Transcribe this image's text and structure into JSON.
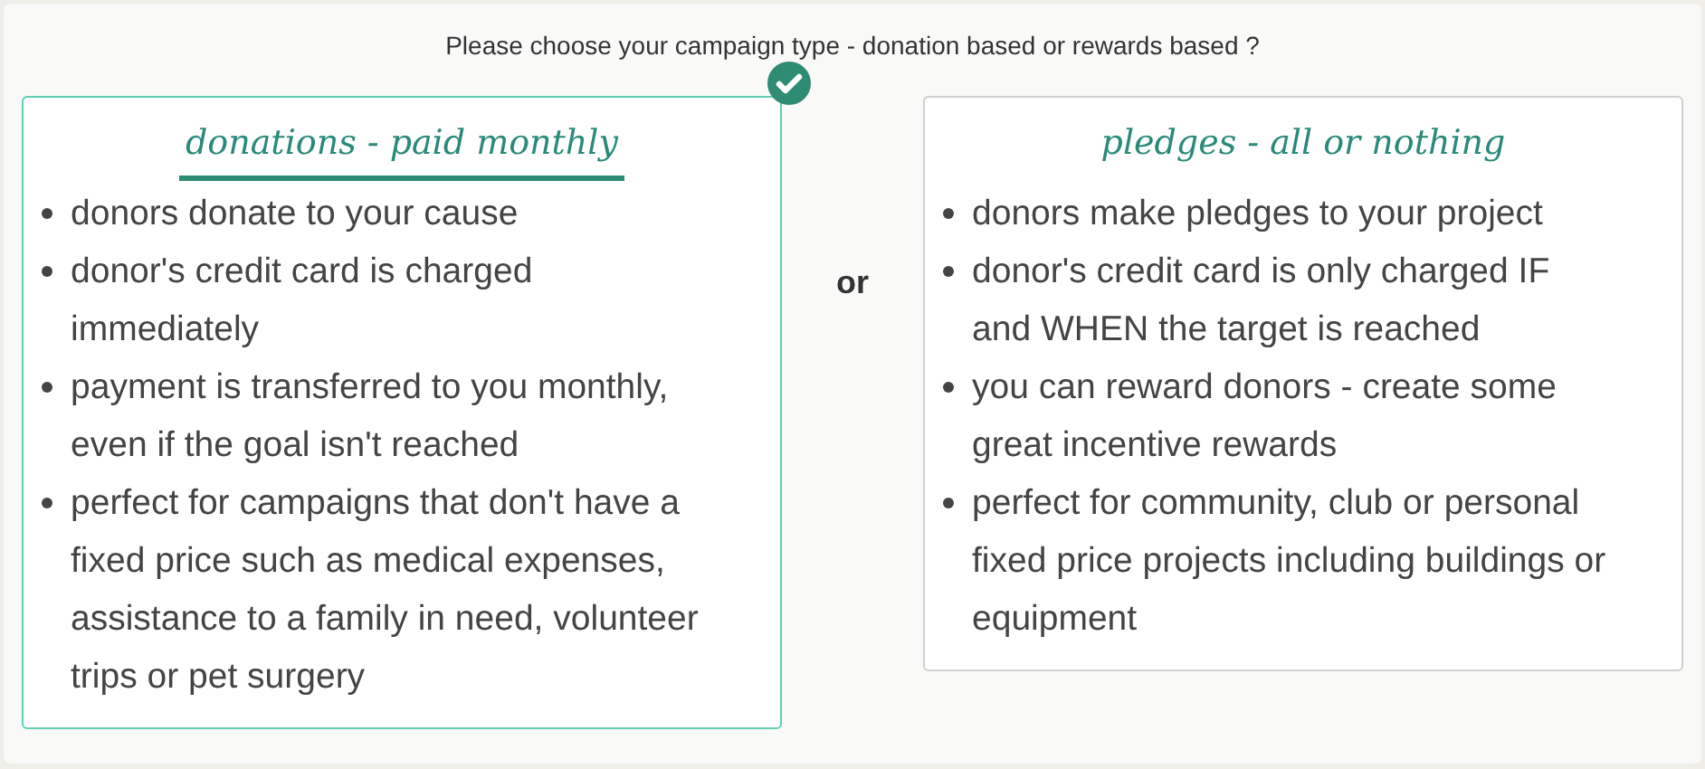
{
  "prompt": "Please choose your campaign type - donation based or rewards based ?",
  "separator": "or",
  "options": [
    {
      "title": "donations - paid monthly",
      "selected": true,
      "points": [
        "donors donate to your cause",
        "donor's credit card is charged immediately",
        "payment is transferred to you monthly, even if the goal isn't reached",
        "perfect for campaigns that don't have a fixed price such as medical expenses, assistance to a family in need, volunteer trips or pet surgery"
      ]
    },
    {
      "title": "pledges - all or nothing",
      "selected": false,
      "points": [
        "donors make pledges to your project",
        "donor's credit card is only charged IF and WHEN the target is reached",
        "you can reward donors - create some great incentive rewards",
        "perfect for community, club or personal fixed price projects including buildings or equipment"
      ]
    }
  ]
}
